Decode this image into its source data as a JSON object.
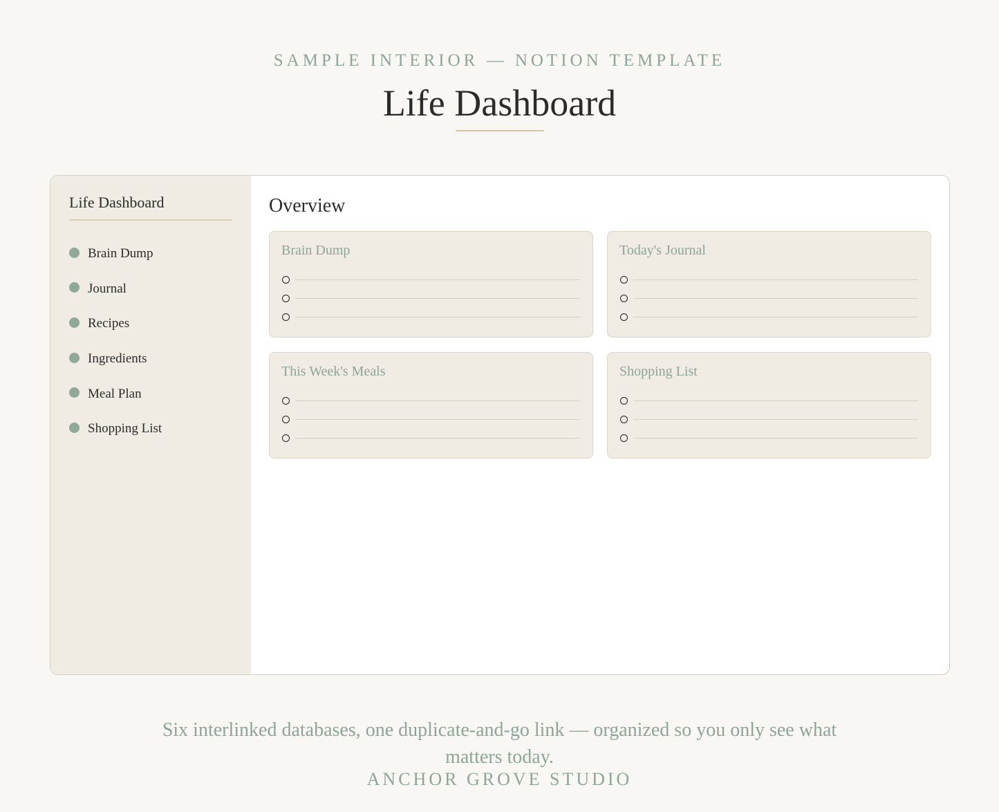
{
  "header": {
    "eyebrow": "SAMPLE INTERIOR — NOTION TEMPLATE",
    "title": "Life Dashboard"
  },
  "sidebar": {
    "title": "Life Dashboard",
    "items": [
      {
        "label": "Brain Dump"
      },
      {
        "label": "Journal"
      },
      {
        "label": "Recipes"
      },
      {
        "label": "Ingredients"
      },
      {
        "label": "Meal Plan"
      },
      {
        "label": "Shopping List"
      }
    ]
  },
  "main": {
    "heading": "Overview",
    "cards": [
      {
        "title": "Brain Dump",
        "rows": 3
      },
      {
        "title": "Today's Journal",
        "rows": 3
      },
      {
        "title": "This Week's Meals",
        "rows": 3
      },
      {
        "title": "Shopping List",
        "rows": 3
      }
    ]
  },
  "footer": {
    "tagline": "Six interlinked databases, one duplicate-and-go link — organized so you only see what matters today.",
    "studio": "ANCHOR GROVE STUDIO"
  },
  "colors": {
    "accent": "#8ea596",
    "sidebar_bg": "#f0ebe3",
    "title_rule": "#d9c4a6"
  }
}
